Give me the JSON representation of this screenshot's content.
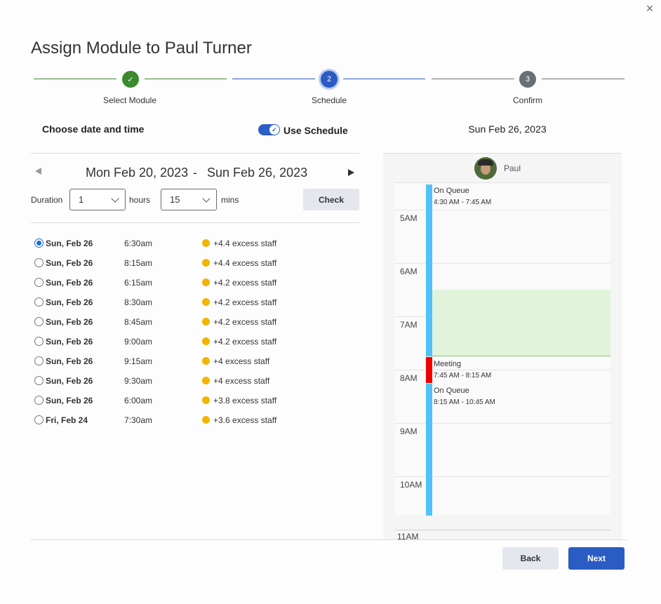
{
  "modal": {
    "title": "Assign Module to Paul Turner",
    "close_glyph": "×"
  },
  "stepper": {
    "steps": [
      {
        "label": "Select Module",
        "number": "1",
        "state": "complete",
        "glyph": "✓"
      },
      {
        "label": "Schedule",
        "number": "2",
        "state": "current"
      },
      {
        "label": "Confirm",
        "number": "3",
        "state": "pending"
      }
    ]
  },
  "chooser": {
    "title": "Choose date and time",
    "toggle_label": "Use Schedule",
    "toggle_on": true,
    "toggle_glyph": "✓"
  },
  "range": {
    "start": "Mon Feb 20, 2023",
    "separator": "-",
    "end": "Sun Feb 26, 2023"
  },
  "duration": {
    "label": "Duration",
    "hours_value": "1",
    "hours_unit": "hours",
    "mins_value": "15",
    "mins_unit": "mins",
    "check_label": "Check"
  },
  "slots": [
    {
      "day": "Sun, Feb 26",
      "time": "6:30am",
      "staff": "+4.4 excess staff",
      "selected": true
    },
    {
      "day": "Sun, Feb 26",
      "time": "8:15am",
      "staff": "+4.4 excess staff",
      "selected": false
    },
    {
      "day": "Sun, Feb 26",
      "time": "6:15am",
      "staff": "+4.2 excess staff",
      "selected": false
    },
    {
      "day": "Sun, Feb 26",
      "time": "8:30am",
      "staff": "+4.2 excess staff",
      "selected": false
    },
    {
      "day": "Sun, Feb 26",
      "time": "8:45am",
      "staff": "+4.2 excess staff",
      "selected": false
    },
    {
      "day": "Sun, Feb 26",
      "time": "9:00am",
      "staff": "+4.2 excess staff",
      "selected": false
    },
    {
      "day": "Sun, Feb 26",
      "time": "9:15am",
      "staff": "+4 excess staff",
      "selected": false
    },
    {
      "day": "Sun, Feb 26",
      "time": "9:30am",
      "staff": "+4 excess staff",
      "selected": false
    },
    {
      "day": "Sun, Feb 26",
      "time": "6:00am",
      "staff": "+3.8 excess staff",
      "selected": false
    },
    {
      "day": "Fri, Feb 24",
      "time": "7:30am",
      "staff": "+3.6 excess staff",
      "selected": false
    }
  ],
  "schedule": {
    "date": "Sun Feb 26, 2023",
    "agent": "Paul",
    "hours": [
      "5AM",
      "6AM",
      "7AM",
      "8AM",
      "9AM",
      "10AM"
    ],
    "last_hour": "11AM",
    "events": [
      {
        "title": "On Queue",
        "time": "4:30 AM - 7:45 AM",
        "color": "#4fc3f7"
      },
      {
        "title": "Meeting",
        "time": "7:45 AM - 8:15 AM",
        "color": "#f20000"
      },
      {
        "title": "On Queue",
        "time": "8:15 AM - 10:45 AM",
        "color": "#4fc3f7"
      }
    ],
    "highlight_color": "#e2f3dc"
  },
  "footer": {
    "back_label": "Back",
    "next_label": "Next"
  },
  "colors": {
    "accent": "#2a5cc4",
    "complete": "#3b8a2e",
    "pending": "#6b6f7a",
    "dot": "#f2b400"
  }
}
